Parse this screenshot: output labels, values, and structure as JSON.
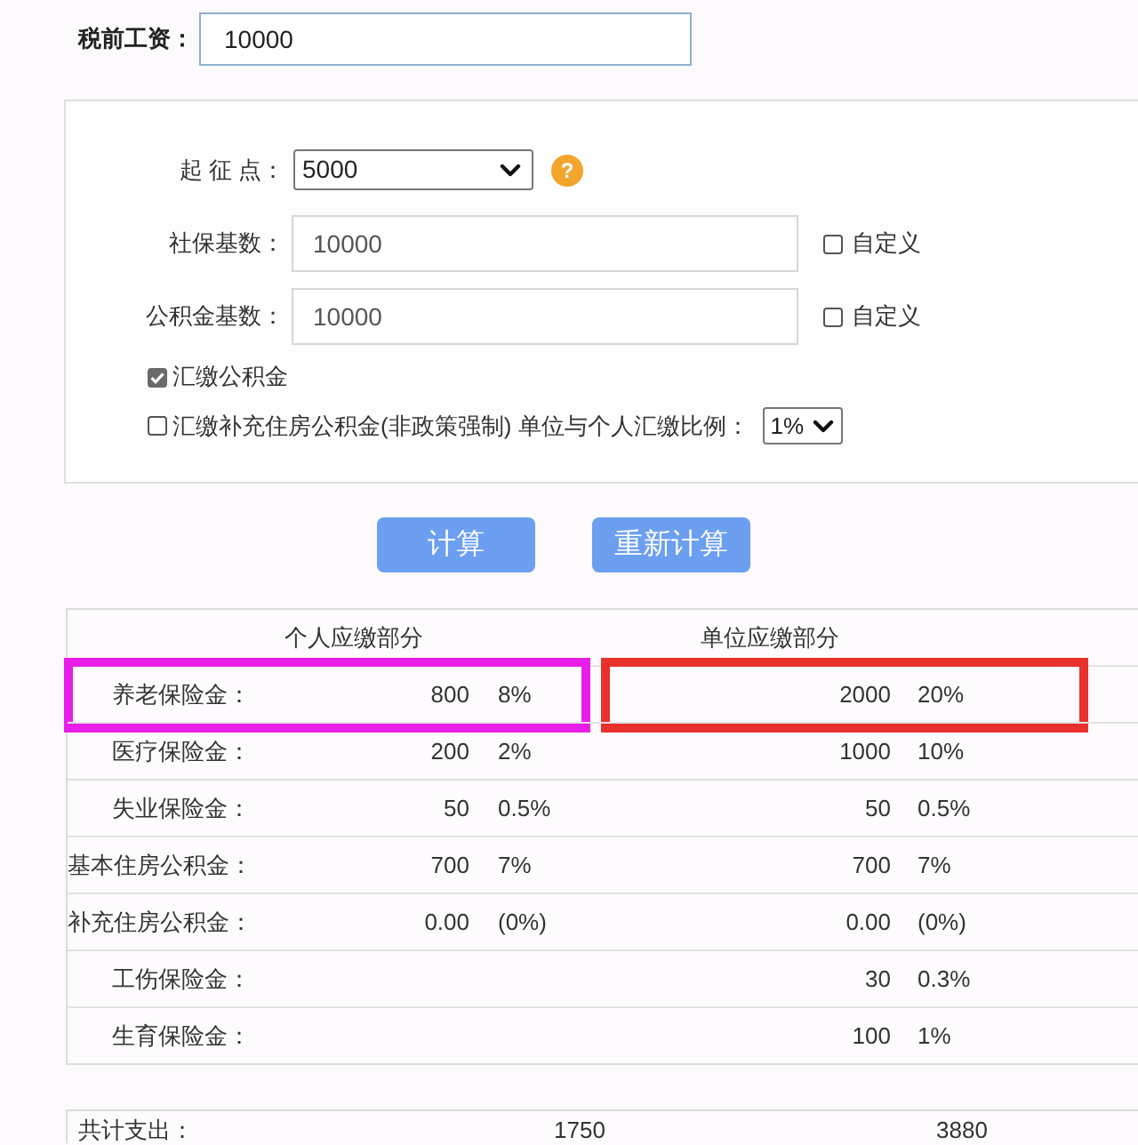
{
  "salary": {
    "label": "税前工资：",
    "value": "10000"
  },
  "settings": {
    "threshold": {
      "label": "起 征 点：",
      "value": "5000",
      "help_icon": "?"
    },
    "fields": [
      {
        "label": "社保基数：",
        "value": "10000",
        "custom": {
          "label": "自定义",
          "checked": false
        }
      },
      {
        "label": "公积金基数：",
        "value": "10000",
        "custom": {
          "label": "自定义",
          "checked": false
        }
      }
    ],
    "options": [
      {
        "label": "汇缴公积金",
        "checked": true
      },
      {
        "label": "汇缴补充住房公积金(非政策强制) 单位与个人汇缴比例：",
        "checked": false,
        "ratio": "1%"
      }
    ]
  },
  "buttons": [
    "计算",
    "重新计算"
  ],
  "table": {
    "columns": [
      "个人应缴部分",
      "单位应缴部分"
    ],
    "rows": [
      {
        "label": "养老保险金：",
        "personal_amount": "800",
        "personal_rate": "8%",
        "company_amount": "2000",
        "company_rate": "20%",
        "personal_highlight": {
          "color": "#e81ee8"
        },
        "company_highlight": {
          "color": "#e8302c"
        }
      },
      {
        "label": "医疗保险金：",
        "personal_amount": "200",
        "personal_rate": "2%",
        "company_amount": "1000",
        "company_rate": "10%"
      },
      {
        "label": "失业保险金：",
        "personal_amount": "50",
        "personal_rate": "0.5%",
        "company_amount": "50",
        "company_rate": "0.5%"
      },
      {
        "label": "基本住房公积金：",
        "personal_amount": "700",
        "personal_rate": "7%",
        "company_amount": "700",
        "company_rate": "7%"
      },
      {
        "label": "补充住房公积金：",
        "personal_amount": "0.00",
        "personal_rate": "(0%)",
        "company_amount": "0.00",
        "company_rate": "(0%)"
      },
      {
        "label": "工伤保险金：",
        "company_amount": "30",
        "company_rate": "0.3%"
      },
      {
        "label": "生育保险金：",
        "company_amount": "100",
        "company_rate": "1%"
      }
    ]
  },
  "total": {
    "label": "共计支出：",
    "personal": "1750",
    "company": "3880"
  }
}
